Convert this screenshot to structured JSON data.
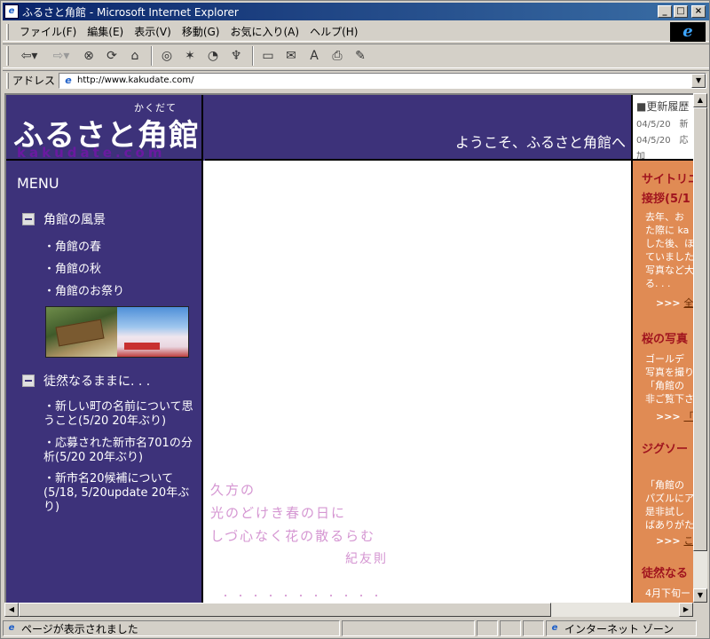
{
  "window": {
    "title": "ふるさと角館 - Microsoft Internet Explorer"
  },
  "menubar": {
    "items": [
      "ファイル(F)",
      "編集(E)",
      "表示(V)",
      "移動(G)",
      "お気に入り(A)",
      "ヘルプ(H)"
    ]
  },
  "toolbar": {
    "icons": [
      "back-arrow-icon",
      "forward-arrow-icon",
      "stop-icon",
      "refresh-icon",
      "home-icon",
      "search-icon",
      "favorites-icon",
      "history-icon",
      "channels-icon",
      "fullscreen-icon",
      "mail-icon",
      "font-icon",
      "print-icon",
      "edit-icon"
    ]
  },
  "address": {
    "label": "アドレス",
    "url": "http://www.kakudate.com/"
  },
  "page": {
    "logo": {
      "ruby": "かくだて",
      "title": "ふるさと角館",
      "domain": "kakudate.com"
    },
    "welcome": "ようこそ、ふるさと角館へ",
    "updates": {
      "title": "■更新履歴",
      "rows": [
        "04/5/20　新",
        "04/5/20　応",
        "加"
      ]
    },
    "sidebar": {
      "menu_title": "MENU",
      "section1": {
        "label": "角館の風景",
        "links": [
          "・角館の春",
          "・角館の秋",
          "・角館のお祭り"
        ]
      },
      "section2": {
        "label": "徒然なるままに. . .",
        "links": [
          "・新しい町の名前について思うこと(5/20 20年ぶり)",
          "・応募された新市名701の分析(5/20 20年ぶり)",
          "・新市名20候補について(5/18, 5/20update 20年ぶり)"
        ]
      }
    },
    "poem": {
      "lines": [
        "久方の",
        "光のどけき春の日に",
        "しづ心なく花の散るらむ"
      ],
      "author": "紀友則",
      "dots": "・・・・・・・・・・・"
    },
    "right": {
      "head1": "サイトリニ",
      "head1b": "接拶(5/1",
      "body1": [
        "去年、お",
        "た際に ka",
        "した後、ほ",
        "ていました",
        "写真など大",
        "る. . ."
      ],
      "link1_prefix": ">>> ",
      "link1": "全文",
      "head2": "桜の写真",
      "body2": [
        "ゴールデ",
        "写真を撮り",
        "「角館の",
        "非ご覧下さ"
      ],
      "link2_prefix": ">>> ",
      "link2": "「角",
      "head3": "ジグソー",
      "body3": [
        "「角館の",
        "パズルにア",
        "是非試し",
        "ばありがた"
      ],
      "link3_prefix": ">>> ",
      "link3": "こち",
      "head4": "徒然なる",
      "body4": [
        "4月下旬ー"
      ]
    }
  },
  "status": {
    "text": "ページが表示されました",
    "zone": "インターネット ゾーン"
  }
}
